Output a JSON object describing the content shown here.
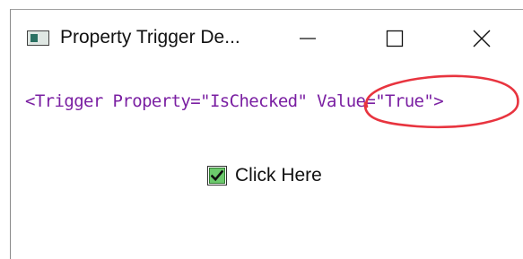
{
  "window": {
    "title": "Property Trigger De...",
    "controls": {
      "minimize": "minimize-icon",
      "maximize": "maximize-icon",
      "close": "close-icon"
    }
  },
  "content": {
    "code": {
      "part1": "<Trigger Property=\"IsChecked\" ",
      "highlighted": "Value=\"True\"",
      "part2": ">"
    },
    "checkbox": {
      "label": "Click Here",
      "checked": true
    }
  },
  "colors": {
    "code_text": "#7a1fa2",
    "highlight_ellipse": "#e8343f",
    "checkbox_fill": "#6cc96c"
  }
}
